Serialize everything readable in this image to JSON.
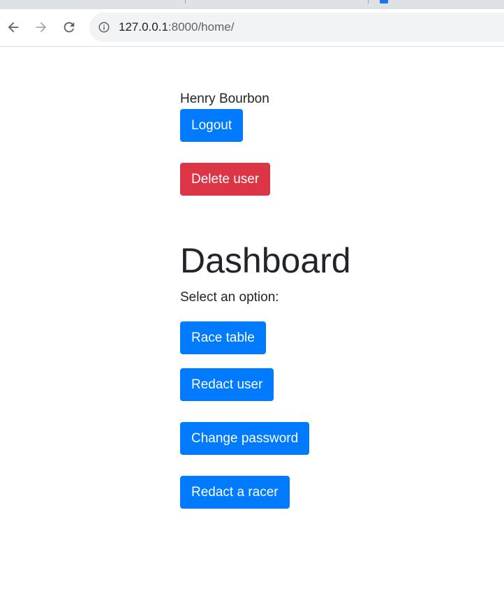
{
  "browser": {
    "url_host": "127.0.0.1",
    "url_rest": ":8000/home/",
    "back_icon": "arrow-left-icon",
    "forward_icon": "arrow-right-icon",
    "reload_icon": "reload-icon",
    "info_icon": "info-icon"
  },
  "user": {
    "name": "Henry Bourbon",
    "logout_label": "Logout",
    "delete_label": "Delete user"
  },
  "dashboard": {
    "title": "Dashboard",
    "prompt": "Select an option:",
    "options": [
      "Race table",
      "Redact user",
      "Change password",
      "Redact a racer"
    ]
  },
  "colors": {
    "primary": "#007bff",
    "danger": "#dc3545",
    "text": "#212529"
  }
}
